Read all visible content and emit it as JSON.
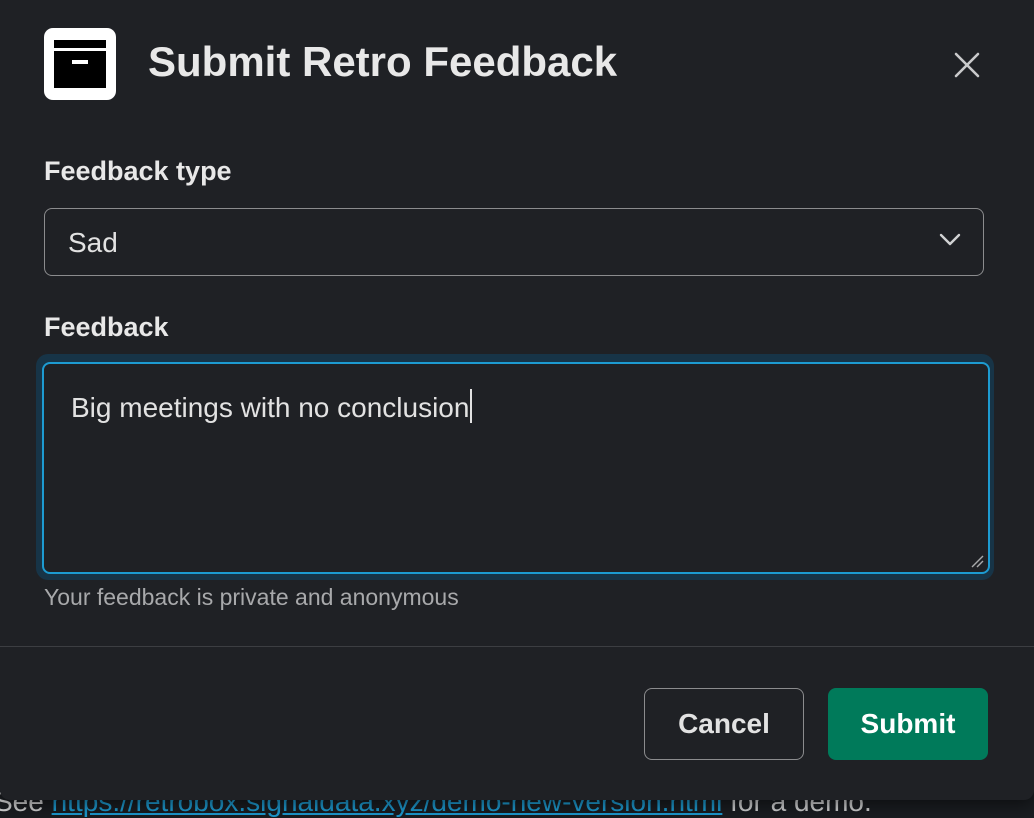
{
  "background": {
    "text_prefix": "See ",
    "link_text": "https://retrobox.signaldata.xyz/demo-new-version.html",
    "text_suffix": " for a demo."
  },
  "modal": {
    "title": "Submit Retro Feedback",
    "app_icon": "archive-box-icon",
    "close_icon": "close-icon"
  },
  "form": {
    "feedback_type": {
      "label": "Feedback type",
      "selected": "Sad",
      "icon": "chevron-down-icon"
    },
    "feedback": {
      "label": "Feedback",
      "value": "Big meetings with no conclusion",
      "hint": "Your feedback is private and anonymous"
    }
  },
  "footer": {
    "cancel_label": "Cancel",
    "submit_label": "Submit"
  },
  "colors": {
    "modal_bg": "#1f2125",
    "focus_border": "#1d9bd1",
    "submit_bg": "#007a5a",
    "text": "#e8e8e8",
    "muted_text": "#a8a9ab"
  }
}
